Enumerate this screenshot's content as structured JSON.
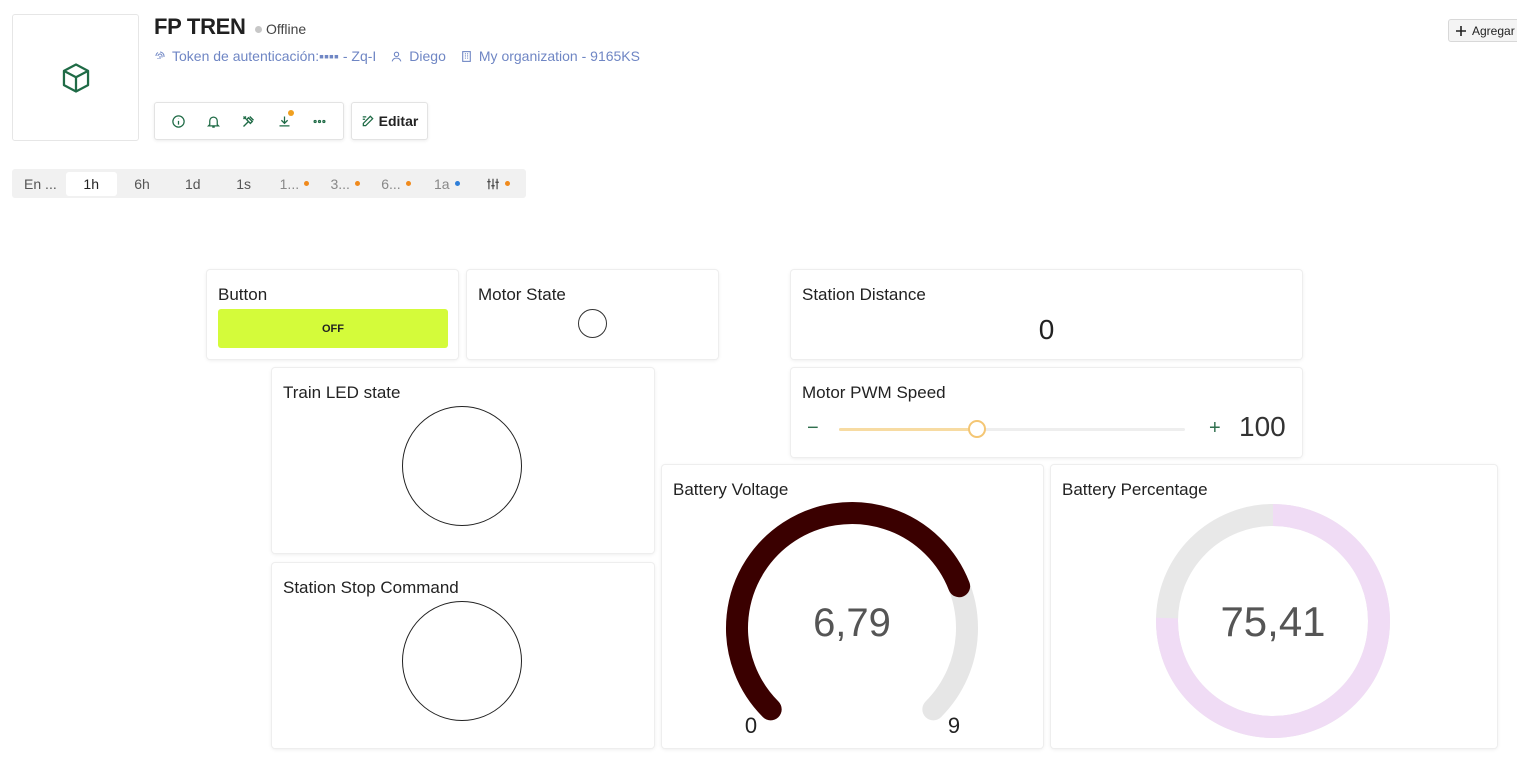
{
  "device": {
    "title": "FP TREN",
    "status": "Offline",
    "token_label": "Token de autenticación:▪▪▪▪ - Zq-I",
    "user": "Diego",
    "organization": "My organization - 9165KS",
    "add_button": "Agregar"
  },
  "toolbar": {
    "edit_label": "Editar",
    "accent": "#1f6b46",
    "badge_color": "#f0a020"
  },
  "time_ranges": [
    {
      "label": "En ...",
      "active": false,
      "dot": null
    },
    {
      "label": "1h",
      "active": true,
      "dot": null
    },
    {
      "label": "6h",
      "active": false,
      "dot": null
    },
    {
      "label": "1d",
      "active": false,
      "dot": null
    },
    {
      "label": "1s",
      "active": false,
      "dot": null
    },
    {
      "label": "1...",
      "active": false,
      "dot": "#f08a1c"
    },
    {
      "label": "3...",
      "active": false,
      "dot": "#f08a1c"
    },
    {
      "label": "6...",
      "active": false,
      "dot": "#f08a1c"
    },
    {
      "label": "1a",
      "active": false,
      "dot": "#2f7fd9"
    },
    {
      "label": "",
      "active": false,
      "dot": "#f08a1c"
    }
  ],
  "widgets": {
    "button": {
      "title": "Button",
      "state_label": "OFF",
      "color": "#d4fb3a"
    },
    "motor_state": {
      "title": "Motor State"
    },
    "station_distance": {
      "title": "Station Distance",
      "value": "0"
    },
    "train_led": {
      "title": "Train LED state"
    },
    "motor_pwm": {
      "title": "Motor PWM Speed",
      "minus": "−",
      "plus": "+",
      "value": "100",
      "fraction": 0.4
    },
    "station_stop": {
      "title": "Station Stop Command"
    },
    "battery_voltage": {
      "title": "Battery Voltage",
      "value_label": "6,79",
      "value": 6.79,
      "min": 0,
      "max": 9,
      "min_label": "0",
      "max_label": "9",
      "color": "#3a0000"
    },
    "battery_percentage": {
      "title": "Battery Percentage",
      "value_label": "75,41",
      "value": 75.41,
      "max": 100,
      "color": "#f0dcf5"
    }
  }
}
